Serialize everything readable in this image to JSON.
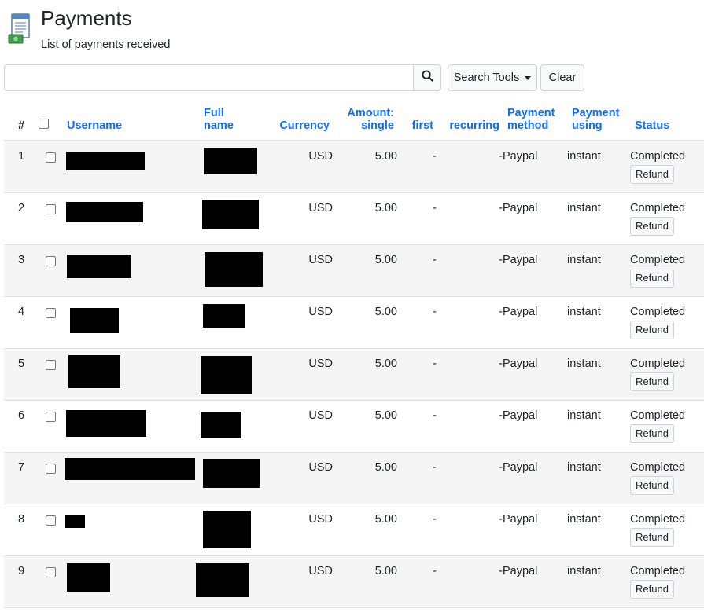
{
  "header": {
    "title": "Payments",
    "subtitle": "List of payments received",
    "icon": "payments-document-icon"
  },
  "toolbar": {
    "search_value": "",
    "search_placeholder": "",
    "search_icon": "search-icon",
    "tools_label": "Search Tools",
    "clear_label": "Clear"
  },
  "table": {
    "columns": {
      "num": "#",
      "username": "Username",
      "fullname": "Full name",
      "currency": "Currency",
      "amount_single": "Amount: single",
      "first": "first",
      "recurring": "recurring",
      "payment_method": "Payment method",
      "payment_using": "Payment using",
      "status": "Status"
    },
    "rows": [
      {
        "num": "1",
        "currency": "USD",
        "single": "5.00",
        "first": "-",
        "recurring": "-",
        "method": "Paypal",
        "using": "instant",
        "status": "Completed",
        "action": "Refund"
      },
      {
        "num": "2",
        "currency": "USD",
        "single": "5.00",
        "first": "-",
        "recurring": "-",
        "method": "Paypal",
        "using": "instant",
        "status": "Completed",
        "action": "Refund"
      },
      {
        "num": "3",
        "currency": "USD",
        "single": "5.00",
        "first": "-",
        "recurring": "-",
        "method": "Paypal",
        "using": "instant",
        "status": "Completed",
        "action": "Refund"
      },
      {
        "num": "4",
        "currency": "USD",
        "single": "5.00",
        "first": "-",
        "recurring": "-",
        "method": "Paypal",
        "using": "instant",
        "status": "Completed",
        "action": "Refund"
      },
      {
        "num": "5",
        "currency": "USD",
        "single": "5.00",
        "first": "-",
        "recurring": "-",
        "method": "Paypal",
        "using": "instant",
        "status": "Completed",
        "action": "Refund"
      },
      {
        "num": "6",
        "currency": "USD",
        "single": "5.00",
        "first": "-",
        "recurring": "-",
        "method": "Paypal",
        "using": "instant",
        "status": "Completed",
        "action": "Refund"
      },
      {
        "num": "7",
        "currency": "USD",
        "single": "5.00",
        "first": "-",
        "recurring": "-",
        "method": "Paypal",
        "using": "instant",
        "status": "Completed",
        "action": "Refund"
      },
      {
        "num": "8",
        "currency": "USD",
        "single": "5.00",
        "first": "-",
        "recurring": "-",
        "method": "Paypal",
        "using": "instant",
        "status": "Completed",
        "action": "Refund"
      },
      {
        "num": "9",
        "currency": "USD",
        "single": "5.00",
        "first": "-",
        "recurring": "-",
        "method": "Paypal",
        "using": "instant",
        "status": "Completed",
        "action": "Refund"
      }
    ]
  },
  "colors": {
    "link": "#0d6efd",
    "redaction": "#000000",
    "stripe": "#f5f5f5"
  }
}
